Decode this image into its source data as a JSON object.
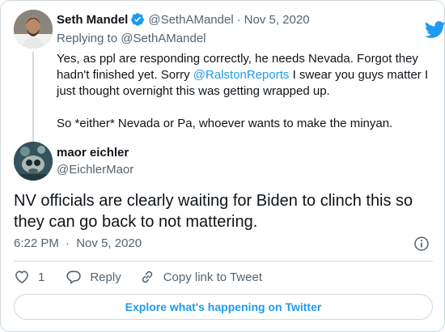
{
  "parent_tweet": {
    "author_name": "Seth Mandel",
    "author_handle": "@SethAMandel",
    "date": "Nov 5, 2020",
    "separator": "·",
    "replying_to_label": "Replying to",
    "replying_to_handle": "@SethAMandel",
    "body_part1": "Yes, as ppl are responding correctly, he needs Nevada. Forgot they hadn't finished yet. Sorry ",
    "body_mention": "@RalstonReports",
    "body_part2": " I swear you guys matter I just thought overnight this was getting wrapped up.",
    "body_paragraph2": "So *either* Nevada or Pa, whoever wants to make the minyan."
  },
  "main_tweet": {
    "author_name": "maor eichler",
    "author_handle": "@EichlerMaor",
    "text": "NV officials are clearly waiting for Biden to clinch this so they can go back to not mattering.",
    "time": "6:22 PM",
    "separator": "·",
    "date": "Nov 5, 2020"
  },
  "actions": {
    "like_count": "1",
    "reply_label": "Reply",
    "copy_link_label": "Copy link to Tweet"
  },
  "explore_label": "Explore what's happening on Twitter",
  "colors": {
    "accent": "#1d9bf0",
    "text": "#0f1419",
    "muted": "#536471",
    "border": "#cfd9de"
  },
  "icons": [
    "verified-badge-icon",
    "twitter-bird-icon",
    "info-icon",
    "heart-icon",
    "reply-bubble-icon",
    "link-icon"
  ]
}
